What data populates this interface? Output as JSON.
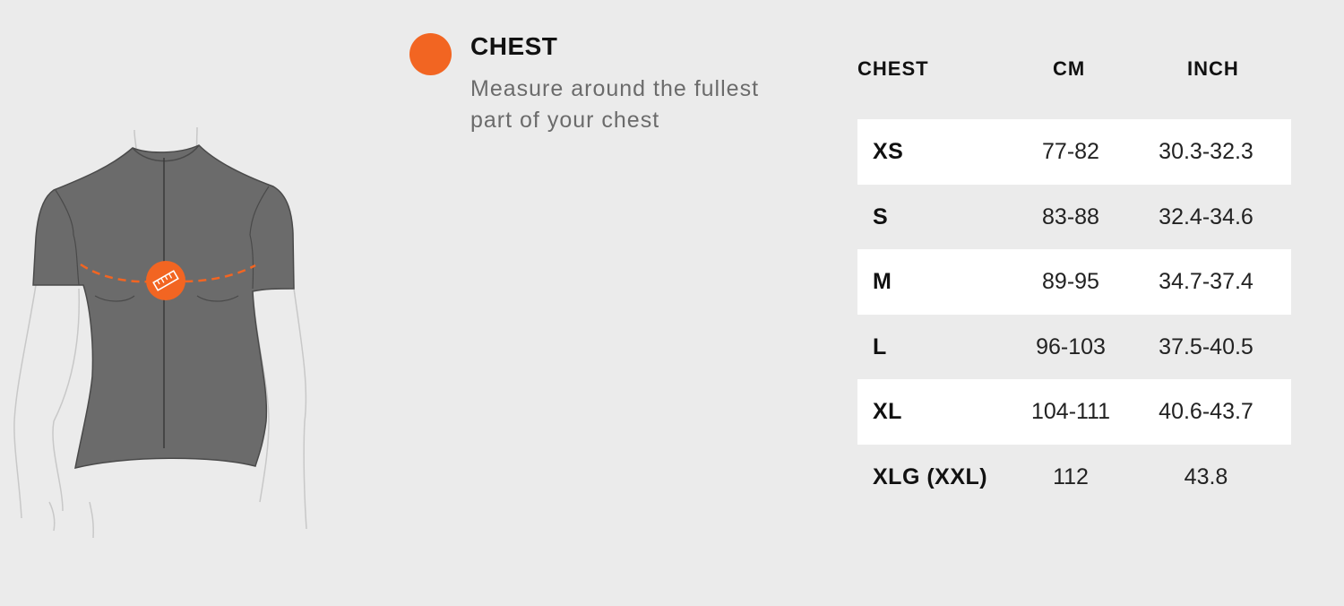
{
  "colors": {
    "accent": "#f26522",
    "background": "#ebebeb",
    "jersey": "#6b6b6b",
    "row_highlight": "#ffffff"
  },
  "illustration": {
    "subject": "cycling-jersey-torso",
    "icon": "ruler-icon"
  },
  "legend": {
    "title": "CHEST",
    "description_line1": "Measure around the fullest",
    "description_line2": "part of your chest"
  },
  "table": {
    "headers": {
      "size": "CHEST",
      "cm": "CM",
      "inch": "INCH"
    },
    "rows": [
      {
        "size": "XS",
        "cm": "77-82",
        "inch": "30.3-32.3"
      },
      {
        "size": "S",
        "cm": "83-88",
        "inch": "32.4-34.6"
      },
      {
        "size": "M",
        "cm": "89-95",
        "inch": "34.7-37.4"
      },
      {
        "size": "L",
        "cm": "96-103",
        "inch": "37.5-40.5"
      },
      {
        "size": "XL",
        "cm": "104-111",
        "inch": "40.6-43.7"
      },
      {
        "size": "XLG (XXL)",
        "cm": "112",
        "inch": "43.8"
      }
    ]
  }
}
